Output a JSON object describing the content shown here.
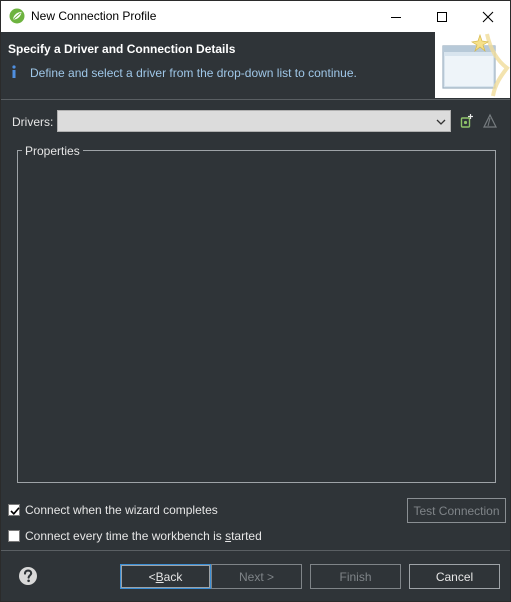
{
  "window": {
    "title": "New Connection Profile"
  },
  "header": {
    "title": "Specify a Driver and Connection Details",
    "description": "Define and select a driver from the drop-down list to continue."
  },
  "drivers": {
    "label": "Drivers:",
    "selected_value": ""
  },
  "properties": {
    "label": "Properties"
  },
  "options": {
    "connect_when_completes": {
      "label": "Connect when the wizard completes",
      "checked": true
    },
    "connect_every_time": {
      "label_pre": "Connect every time the workbench is ",
      "label_u": "s",
      "label_post": "tarted",
      "checked": false
    }
  },
  "buttons": {
    "test_connection": "Test Connection",
    "back_pre": "< ",
    "back_u": "B",
    "back_post": "ack",
    "next": "Next >",
    "finish": "Finish",
    "cancel": "Cancel"
  },
  "icons": {
    "app": "spring-leaf-icon",
    "info": "info-icon",
    "banner": "wizard-banner-icon",
    "new_driver": "new-driver-icon",
    "edit_driver": "edit-driver-icon",
    "help": "help-icon"
  },
  "colors": {
    "background": "#2f3438",
    "title_bar": "#ffffff",
    "description_text": "#9fc7e8",
    "focus_border": "#3b8fd6",
    "spring_green": "#6db33f"
  }
}
